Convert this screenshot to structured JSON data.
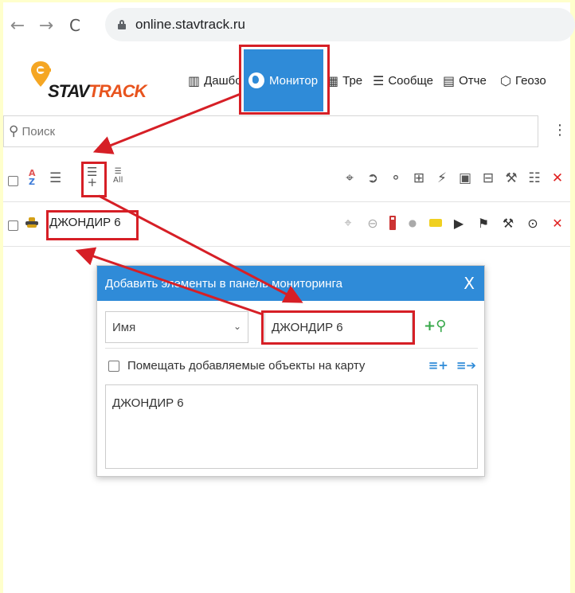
{
  "browser": {
    "back_glyph": "←",
    "forward_glyph": "→",
    "reload_glyph": "C",
    "url": "online.stavtrack.ru"
  },
  "logo": {
    "text_stav": "STAV",
    "text_track": "TRACK"
  },
  "menu": {
    "items": [
      {
        "label": "Дашбо",
        "icon": "dashboard-icon"
      },
      {
        "label": "Монитор",
        "icon": "globe-icon",
        "active": true
      },
      {
        "label": "Тре",
        "icon": "tracks-icon"
      },
      {
        "label": "Сообще",
        "icon": "messages-icon"
      },
      {
        "label": "Отче",
        "icon": "reports-icon"
      },
      {
        "label": "Геозо",
        "icon": "geozones-icon"
      }
    ]
  },
  "search": {
    "placeholder": "Поиск"
  },
  "unit": {
    "name": "ДЖОНДИР 6"
  },
  "toolbar": {
    "all_label": "All"
  },
  "dialog": {
    "title": "Добавить элементы в панель мониторинга",
    "close_glyph": "X",
    "select_value": "Имя",
    "input_value": "ДЖОНДИР 6",
    "checkbox_label": "Помещать добавляемые объекты на карту",
    "results": [
      "ДЖОНДИР 6"
    ]
  },
  "colors": {
    "accent": "#2f8bd8",
    "annotation": "#d61f26",
    "page_bg": "#ffffcc",
    "logo_track": "#e8541e"
  }
}
